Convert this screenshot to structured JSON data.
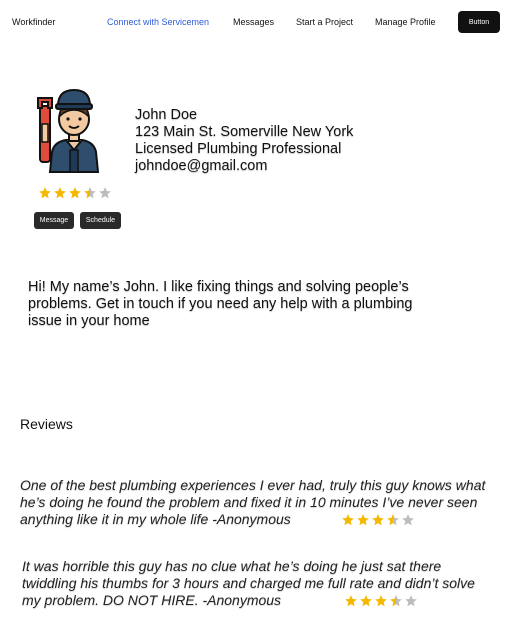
{
  "nav": {
    "brand": "Workfinder",
    "links": [
      "Connect with Servicemen",
      "Messages",
      "Start a Project",
      "Manage Profile"
    ],
    "button": "Button",
    "accent": "#2f5bd9"
  },
  "profile": {
    "avatar_icon": "plumber-avatar-icon",
    "name": "John Doe",
    "address": "123 Main St. Somerville New York",
    "title": "Licensed Plumbing Professional",
    "email": "johndoe@gmail.com",
    "rating": 3.5,
    "rating_max": 5,
    "message_label": "Message",
    "schedule_label": "Schedule"
  },
  "bio": "Hi! My name’s John. I like fixing things and solving people’s problems. Get in touch if you need any help with a plumbing issue in your home",
  "reviews": {
    "title": "Reviews",
    "items": [
      {
        "text": "One of the best plumbing experiences I ever had, truly this guy knows what he’s doing he found the problem and fixed it in 10 minutes I’ve never seen anything like it in my whole life -Anonymous",
        "rating": 3.5
      },
      {
        "text": "It was horrible this guy has no clue what he’s doing he just sat there twiddling his thumbs for 3 hours and charged me full rate and didn’t solve my problem. DO NOT HIRE. -Anonymous",
        "rating": 3.5
      }
    ]
  },
  "colors": {
    "star_filled": "#f5b800",
    "star_empty": "#bdbdbd"
  }
}
